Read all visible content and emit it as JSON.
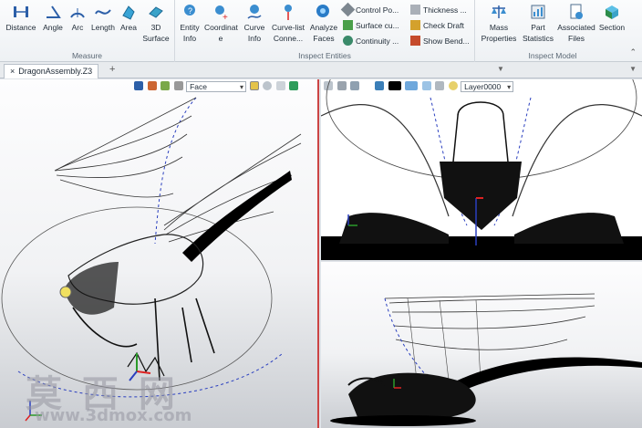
{
  "ribbon": {
    "measure": {
      "group_label": "Measure",
      "buttons": [
        {
          "l1": "Distance",
          "l2": "",
          "icon": "distance-icon"
        },
        {
          "l1": "Angle",
          "l2": "",
          "icon": "angle-icon"
        },
        {
          "l1": "Arc",
          "l2": "",
          "icon": "arc-icon"
        },
        {
          "l1": "Length",
          "l2": "",
          "icon": "length-icon"
        },
        {
          "l1": "Area",
          "l2": "",
          "icon": "area-icon"
        },
        {
          "l1": "3D",
          "l2": "Surface",
          "icon": "3d-surface-icon"
        }
      ]
    },
    "inspect_entities": {
      "group_label": "Inspect Entities",
      "buttons": [
        {
          "l1": "Entity",
          "l2": "Info",
          "icon": "entity-info-icon"
        },
        {
          "l1": "Coordinat",
          "l2": "e",
          "icon": "coordinate-icon"
        },
        {
          "l1": "Curve",
          "l2": "Info",
          "icon": "curve-info-icon"
        },
        {
          "l1": "Curve-list",
          "l2": "Conne...",
          "icon": "curve-list-icon"
        },
        {
          "l1": "Analyze",
          "l2": "Faces",
          "icon": "analyze-faces-icon"
        }
      ],
      "small": [
        "Control Po...",
        "Surface cu...",
        "Continuity ...",
        "Thickness ...",
        "Check Draft",
        "Show Bend..."
      ]
    },
    "inspect_model": {
      "group_label": "Inspect Model",
      "buttons": [
        {
          "l1": "Mass",
          "l2": "Properties",
          "icon": "mass-properties-icon"
        },
        {
          "l1": "Part",
          "l2": "Statistics",
          "icon": "part-statistics-icon"
        },
        {
          "l1": "Associated",
          "l2": "Files",
          "icon": "associated-files-icon"
        },
        {
          "l1": "Section",
          "l2": "",
          "icon": "section-icon"
        }
      ]
    }
  },
  "tabs": {
    "document": "DragonAssembly.Z3",
    "close": "×",
    "add": "+"
  },
  "viewport_left": {
    "filter_dropdown": "Face"
  },
  "viewport_right": {
    "layer_dropdown": "Layer0000"
  },
  "watermark": {
    "chars": "莫 西 网",
    "url": "www.3dmox.com"
  },
  "colors": {
    "accent_red": "#cc4444",
    "dashed_blue": "#2a3fbf",
    "ribbon_bg": "#f3f5f7"
  }
}
